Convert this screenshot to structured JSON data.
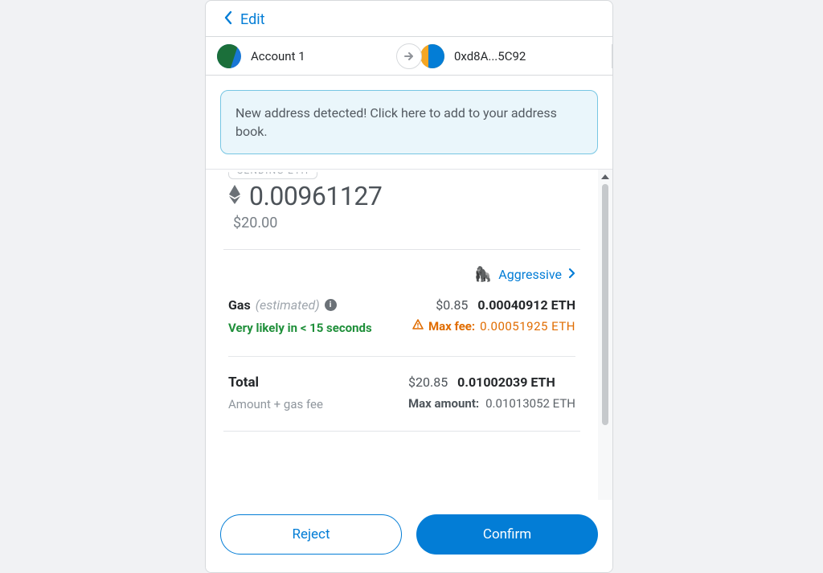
{
  "header": {
    "edit_label": "Edit"
  },
  "accounts": {
    "from_label": "Account 1",
    "to_label": "0xd8A...5C92"
  },
  "notice": {
    "text": "New address detected! Click here to add to your address book."
  },
  "send": {
    "pill": "SENDING ETH",
    "amount_crypto": "0.00961127",
    "amount_fiat": "$20.00"
  },
  "gas": {
    "mode_label": "Aggressive",
    "label": "Gas",
    "estimated_suffix": "(estimated)",
    "fiat": "$0.85",
    "crypto": "0.00040912 ETH",
    "likely_text": "Very likely in < 15 seconds",
    "maxfee_label": "Max fee:",
    "maxfee_value": "0.00051925 ETH"
  },
  "total": {
    "label": "Total",
    "sub_label": "Amount + gas fee",
    "fiat": "$20.85",
    "crypto": "0.01002039 ETH",
    "maxamount_label": "Max amount:",
    "maxamount_value": "0.01013052 ETH"
  },
  "footer": {
    "reject_label": "Reject",
    "confirm_label": "Confirm"
  }
}
